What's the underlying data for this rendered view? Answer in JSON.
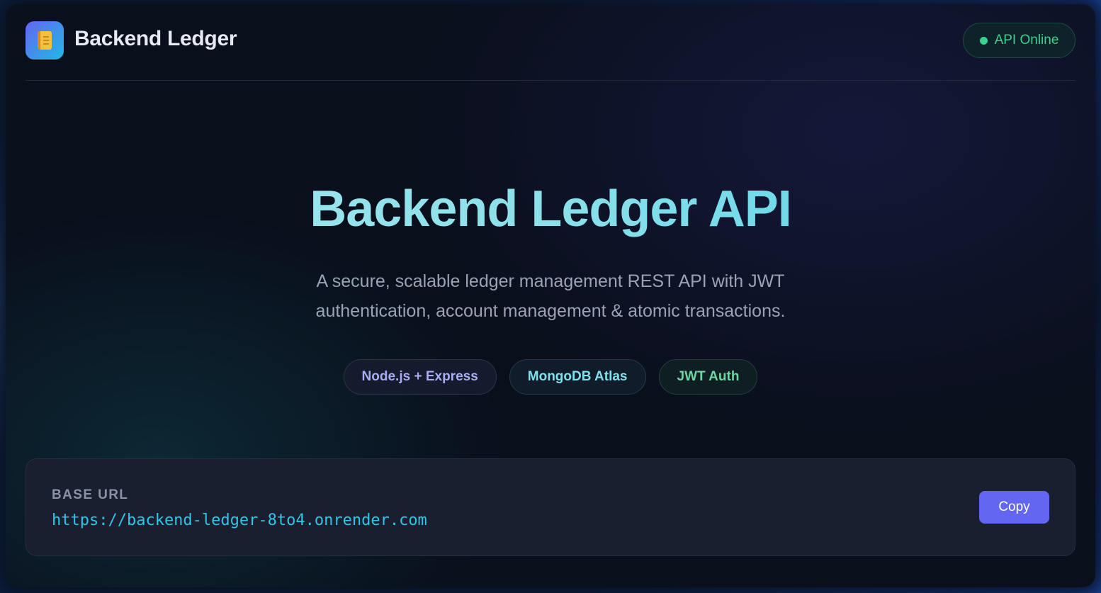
{
  "header": {
    "brand": "Backend Ledger",
    "logo_icon": "notebook-icon",
    "status_text": "API Online",
    "status_color": "#3ccf8e"
  },
  "hero": {
    "title": "Backend Ledger API",
    "description": "A secure, scalable ledger management REST API with JWT authentication, account management & atomic transactions."
  },
  "tags": [
    {
      "label": "Node.js + Express",
      "color": "#a7acf5"
    },
    {
      "label": "MongoDB Atlas",
      "color": "#7fe0ec"
    },
    {
      "label": "JWT Auth",
      "color": "#6fd6a0"
    }
  ],
  "base": {
    "label": "BASE URL",
    "url": "https://backend-ledger-8to4.onrender.com",
    "copy_label": "Copy",
    "accent": "#6366f1"
  }
}
